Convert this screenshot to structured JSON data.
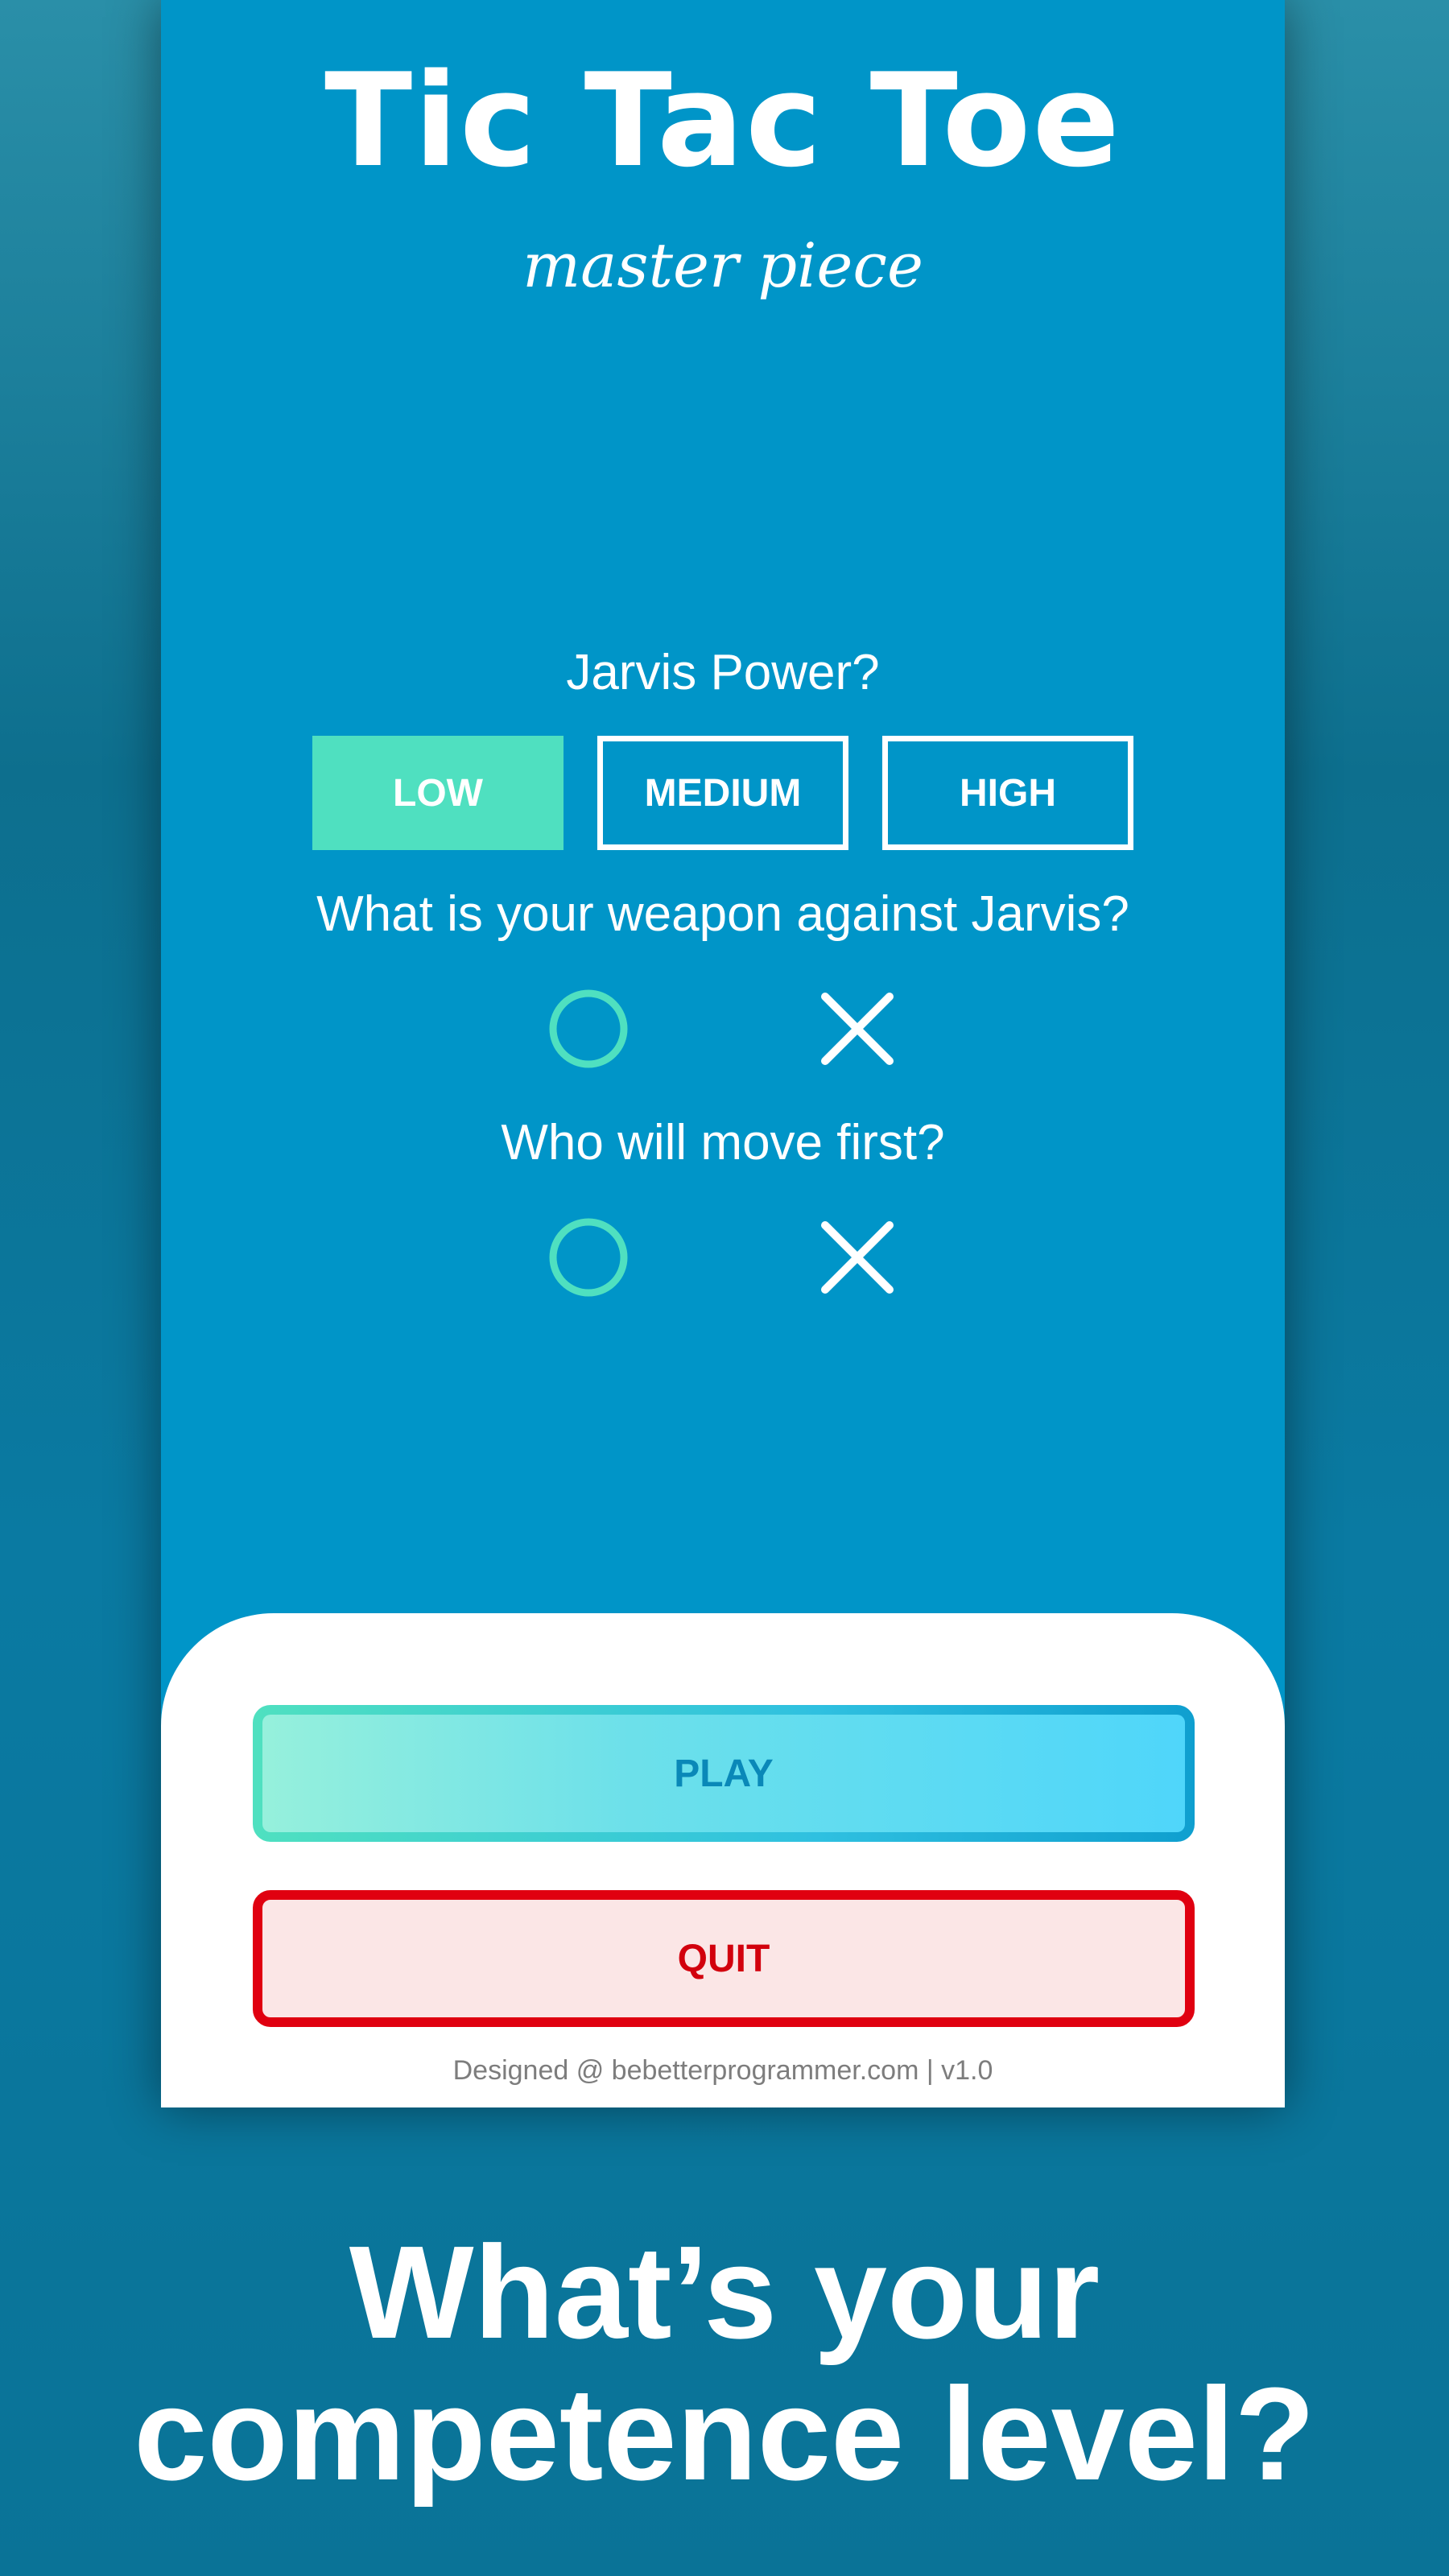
{
  "app": {
    "title": "Tic Tac Toe",
    "subtitle": "master piece"
  },
  "settings": {
    "power_question": "Jarvis Power?",
    "power_options": [
      {
        "label": "LOW",
        "selected": true
      },
      {
        "label": "MEDIUM",
        "selected": false
      },
      {
        "label": "HIGH",
        "selected": false
      }
    ],
    "weapon_question": "What is your weapon against Jarvis?",
    "weapon_options": [
      {
        "symbol": "O",
        "icon": "circle-icon"
      },
      {
        "symbol": "X",
        "icon": "cross-icon"
      }
    ],
    "first_move_question": "Who will move first?",
    "first_move_options": [
      {
        "symbol": "O",
        "icon": "circle-icon"
      },
      {
        "symbol": "X",
        "icon": "cross-icon"
      }
    ]
  },
  "actions": {
    "play_label": "PLAY",
    "quit_label": "QUIT"
  },
  "footer": {
    "credit": "Designed @ bebetterprogrammer.com | v1.0"
  },
  "promo": {
    "line1": "What’s your",
    "line2": "competence level?"
  },
  "colors": {
    "background": "#0a7397",
    "screen": "#0095c8",
    "accent_teal": "#4fe0c0",
    "play_text": "#0a88b8",
    "quit_red": "#e00010",
    "quit_bg": "#fbe6e6",
    "white": "#ffffff"
  }
}
